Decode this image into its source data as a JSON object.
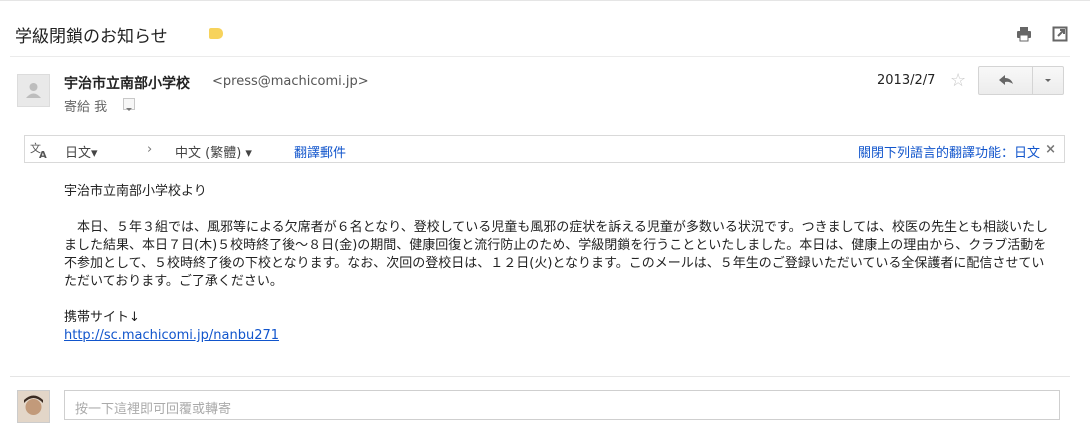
{
  "subject": "学級閉鎖のお知らせ",
  "colors": {
    "label": "#f7d35c",
    "link": "#1155cc"
  },
  "sender": {
    "name": "宇治市立南部小学校",
    "email": "<press@machicomi.jp>",
    "to": "寄給 我",
    "date": "2013/2/7"
  },
  "icons": {
    "print": "print-icon",
    "newwindow": "new-window-icon",
    "star": "star-icon",
    "reply": "reply-icon",
    "more": "chevron-down-icon",
    "translate": "translate-icon"
  },
  "translate_bar": {
    "source": "日文▾",
    "arrow": "›",
    "target": "中文 (繁體) ▾",
    "translate_link": "翻譯郵件",
    "turn_off": "關閉下列語言的翻譯功能：日文",
    "close": "×"
  },
  "body": {
    "greeting": "宇治市立南部小学校より",
    "paragraph": "　本日、５年３組では、風邪等による欠席者が６名となり、登校している児童も風邪の症状を訴える児童が多数いる状況です。つきましては、校医の先生とも相談いたしました結果、本日７日(木)５校時終了後～８日(金)の期間、健康回復と流行防止のため、学級閉鎖を行うことといたしました。本日は、健康上の理由から、クラブ活動を不参加として、５校時終了後の下校となります。なお、次回の登校日は、１２日(火)となります。このメールは、５年生のご登録いただいている全保護者に配信させていただいております。ご了承ください。",
    "mobile_label": "携帯サイト↓",
    "link": "http://sc.machicomi.jp/nanbu271"
  },
  "reply_placeholder": "按一下這裡即可回覆或轉寄"
}
